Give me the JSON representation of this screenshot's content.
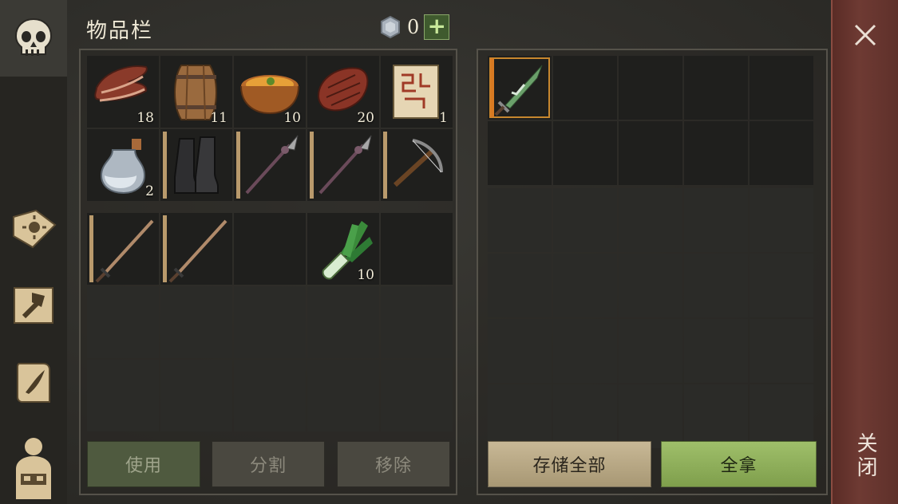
{
  "title": "物品栏",
  "currency": {
    "icon": "silver-coin-icon",
    "value": "0",
    "add_label": "+"
  },
  "sidebar": [
    {
      "icon": "skull-icon",
      "active": true
    },
    {
      "icon": "book-sun-icon"
    },
    {
      "icon": "hammer-map-icon"
    },
    {
      "icon": "scroll-feather-icon"
    },
    {
      "icon": "character-backpack-icon"
    }
  ],
  "inventory": {
    "row1": [
      {
        "item": "bacon-icon",
        "count": "18"
      },
      {
        "item": "barrel-icon",
        "count": "11"
      },
      {
        "item": "soup-bowl-icon",
        "count": "10"
      },
      {
        "item": "steak-icon",
        "count": "20"
      },
      {
        "item": "map-scroll-icon",
        "count": "1"
      }
    ],
    "row2": [
      {
        "item": "potion-bottle-icon",
        "count": "2"
      },
      {
        "item": "boots-icon",
        "count": ""
      },
      {
        "item": "spear-icon",
        "count": ""
      },
      {
        "item": "spear-icon",
        "count": ""
      },
      {
        "item": "crossbow-icon",
        "count": ""
      }
    ],
    "row3": [
      {
        "item": "sword-icon",
        "count": ""
      },
      {
        "item": "sword-icon",
        "count": ""
      },
      {
        "item": "",
        "count": ""
      },
      {
        "item": "leek-icon",
        "count": "10"
      },
      {
        "item": "",
        "count": ""
      }
    ]
  },
  "storage": {
    "items": [
      {
        "item": "green-dagger-icon",
        "count": ""
      }
    ]
  },
  "buttons": {
    "use": "使用",
    "split": "分割",
    "remove": "移除",
    "store_all": "存储全部",
    "take_all": "全拿"
  },
  "close": {
    "label": "关闭"
  },
  "colors": {
    "accent_green": "#8fae5c",
    "close_red": "#6e3a33",
    "durability": "#b99a6c"
  }
}
